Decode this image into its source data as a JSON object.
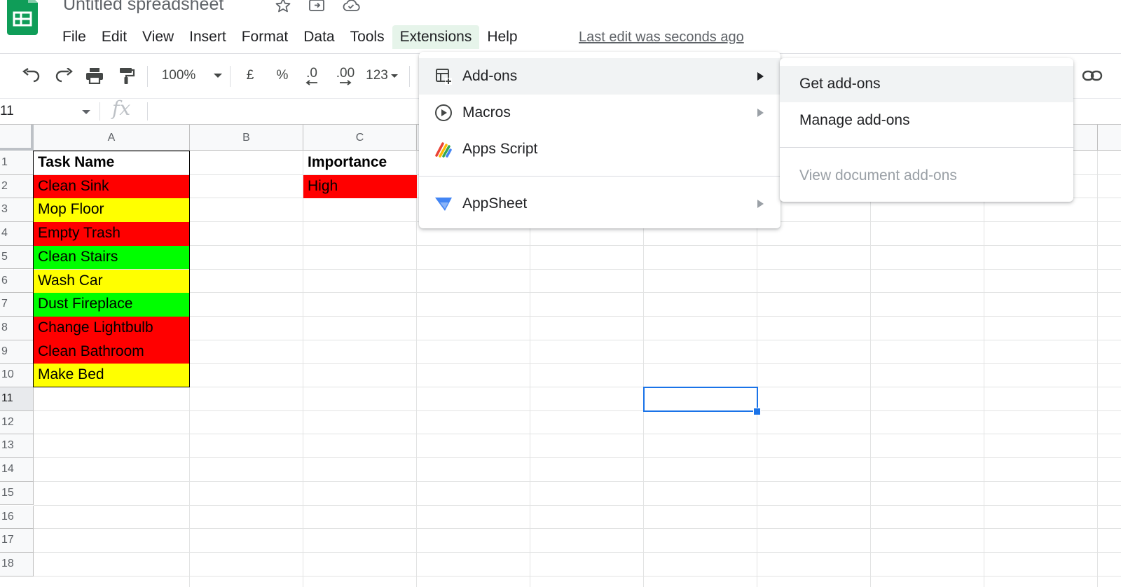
{
  "app": {
    "title": "Untitled spreadsheet",
    "last_edit": "Last edit was seconds ago"
  },
  "menubar": [
    "File",
    "Edit",
    "View",
    "Insert",
    "Format",
    "Data",
    "Tools",
    "Extensions",
    "Help"
  ],
  "active_menu": "Extensions",
  "toolbar": {
    "zoom": "100%",
    "currency": "£",
    "percent": "%",
    "decrease_decimals": ".0",
    "increase_decimals": ".00",
    "format_more": "123"
  },
  "formula_bar": {
    "name_box": "11",
    "fx": "fx",
    "value": ""
  },
  "grid": {
    "columns": [
      "A",
      "B",
      "C"
    ],
    "rows": [
      "1",
      "2",
      "3",
      "4",
      "5",
      "6",
      "7",
      "8",
      "9",
      "10",
      "11",
      "12",
      "13",
      "14",
      "15",
      "16",
      "17",
      "18"
    ],
    "selected_row": "11",
    "header_task": "Task Name",
    "header_importance": "Importance",
    "tasks": [
      {
        "name": "Clean Sink",
        "color": "#ff0000"
      },
      {
        "name": "Mop Floor",
        "color": "#ffff00"
      },
      {
        "name": "Empty Trash",
        "color": "#ff0000"
      },
      {
        "name": "Clean Stairs",
        "color": "#00ff00"
      },
      {
        "name": "Wash Car",
        "color": "#ffff00"
      },
      {
        "name": "Dust Fireplace",
        "color": "#00ff00"
      },
      {
        "name": "Change Lightbulb",
        "color": "#ff0000"
      },
      {
        "name": "Clean Bathroom",
        "color": "#ff0000"
      },
      {
        "name": "Make Bed",
        "color": "#ffff00"
      }
    ],
    "importance": [
      {
        "value": "High",
        "color": "#ff0000"
      }
    ]
  },
  "extensions_menu": {
    "items": [
      {
        "label": "Add-ons",
        "icon": "add-ons-icon",
        "submenu": true
      },
      {
        "label": "Macros",
        "icon": "macros-play-icon",
        "submenu": true
      },
      {
        "label": "Apps Script",
        "icon": "apps-script-icon",
        "submenu": false
      },
      {
        "label": "AppSheet",
        "icon": "appsheet-icon",
        "submenu": true
      }
    ]
  },
  "addons_submenu": {
    "items": [
      {
        "label": "Get add-ons",
        "enabled": true
      },
      {
        "label": "Manage add-ons",
        "enabled": true
      },
      {
        "label": "View document add-ons",
        "enabled": false
      }
    ]
  },
  "colors": {
    "accent_blue": "#1a73e8",
    "sheets_green": "#0f9d58",
    "menu_active_bg": "#e6f4ea"
  }
}
